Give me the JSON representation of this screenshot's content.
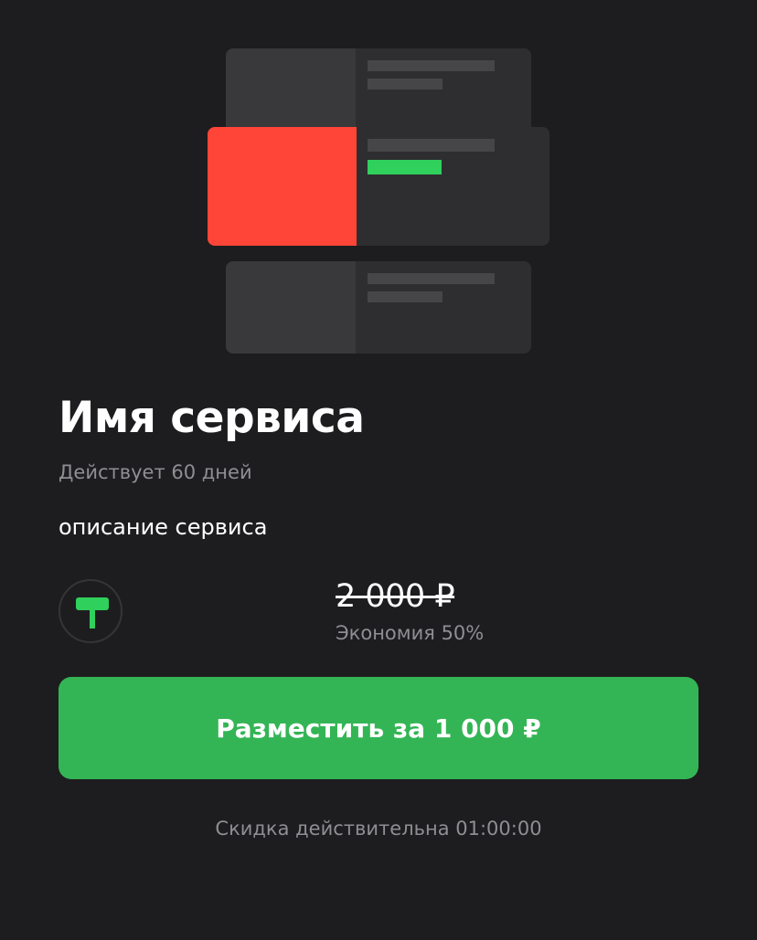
{
  "illustration": {
    "icon": "listing-promotion-illustration",
    "colors": {
      "highlight": "#ff4537",
      "accent": "#2fd05b"
    }
  },
  "service": {
    "title": "Имя сервиса",
    "validity": "Действует 60 дней",
    "description": "описание сервиса"
  },
  "pricing": {
    "icon": "promotion-flag-icon",
    "old_price": "2 000 ₽",
    "savings": "Экономия 50%"
  },
  "actions": {
    "place_button_label": "Разместить за 1 000 ₽",
    "button_color": "#34b555"
  },
  "footer": {
    "discount_timer": "Скидка действительна 01:00:00"
  }
}
